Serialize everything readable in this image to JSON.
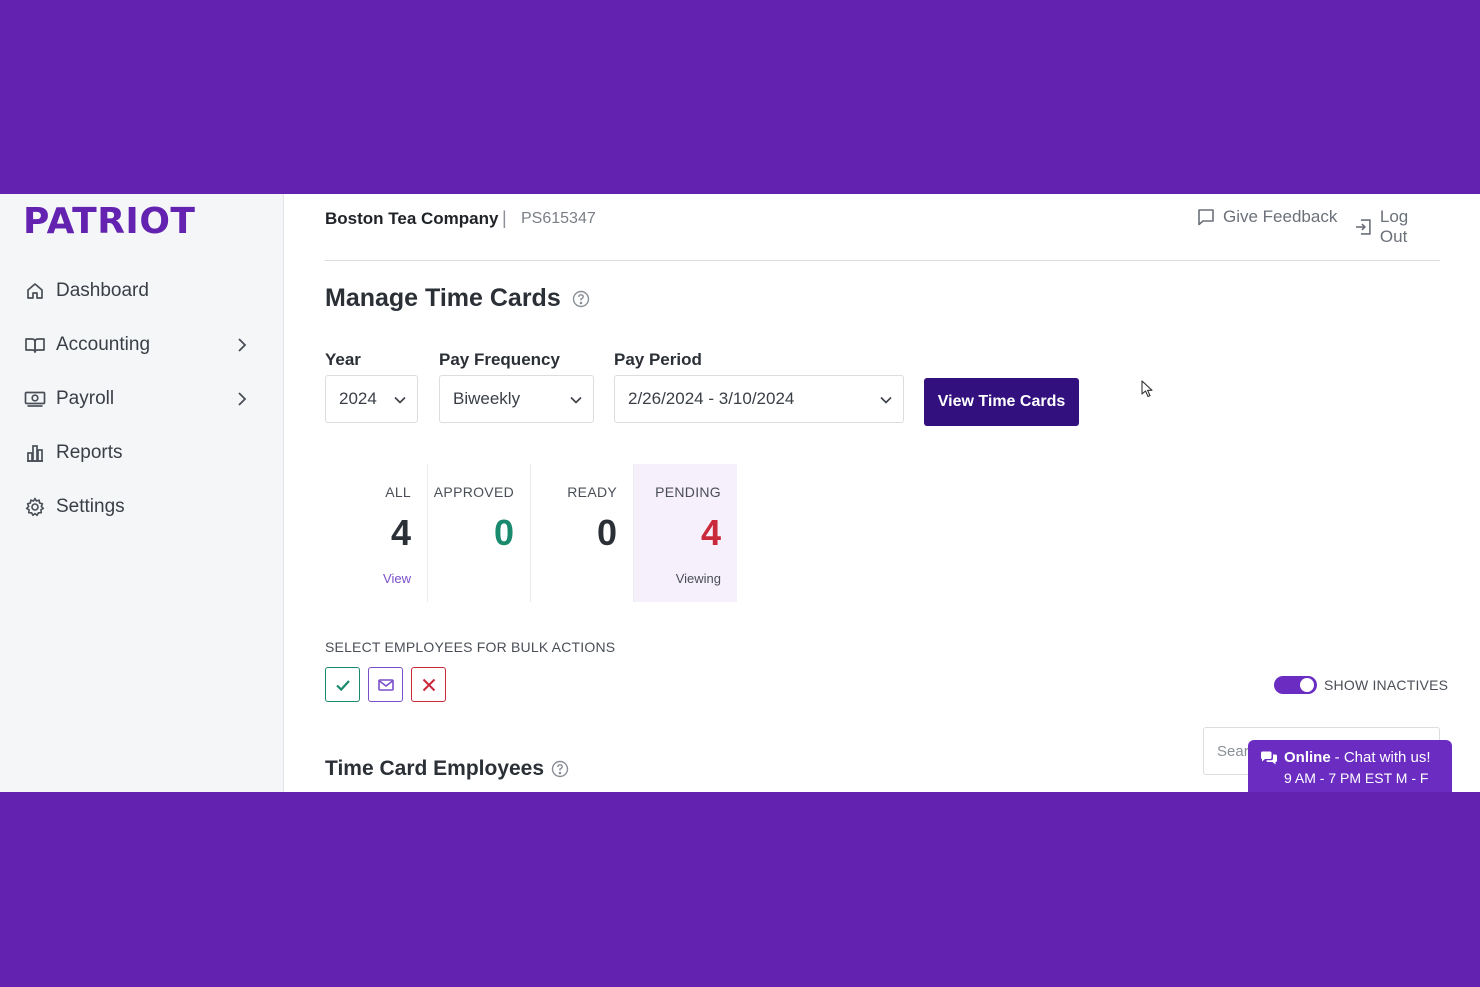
{
  "brand": {
    "logo": "PATRIOT",
    "color": "#6322b0"
  },
  "sidebar": {
    "items": [
      {
        "label": "Dashboard",
        "icon": "home-icon",
        "has_submenu": false
      },
      {
        "label": "Accounting",
        "icon": "book-icon",
        "has_submenu": true
      },
      {
        "label": "Payroll",
        "icon": "money-icon",
        "has_submenu": true
      },
      {
        "label": "Reports",
        "icon": "bar-chart-icon",
        "has_submenu": false
      },
      {
        "label": "Settings",
        "icon": "gear-icon",
        "has_submenu": false
      }
    ]
  },
  "header": {
    "company_name": "Boston Tea Company",
    "separator": "|",
    "company_id": "PS615347",
    "feedback_label": "Give Feedback",
    "logout_label": "Log Out"
  },
  "main": {
    "title": "Manage Time Cards",
    "filters": {
      "year_label": "Year",
      "year_value": "2024",
      "frequency_label": "Pay Frequency",
      "frequency_value": "Biweekly",
      "period_label": "Pay Period",
      "period_value": "2/26/2024 - 3/10/2024"
    },
    "view_button_label": "View Time Cards",
    "status_tiles": [
      {
        "label": "ALL",
        "count": "4",
        "sub": "View",
        "color": "#2b2f36"
      },
      {
        "label": "APPROVED",
        "count": "0",
        "sub": "",
        "color": "#1a8a6e"
      },
      {
        "label": "READY",
        "count": "0",
        "sub": "",
        "color": "#2b2f36"
      },
      {
        "label": "PENDING",
        "count": "4",
        "sub": "Viewing",
        "color": "#c9293a"
      }
    ],
    "bulk_label": "SELECT EMPLOYEES FOR BULK ACTIONS",
    "show_inactives_label": "SHOW INACTIVES",
    "show_inactives_on": true,
    "section_title": "Time Card Employees",
    "search_placeholder": "Search"
  },
  "chat": {
    "status": "Online",
    "message": "- Chat with us!",
    "hours": "9 AM - 7 PM EST M - F"
  }
}
